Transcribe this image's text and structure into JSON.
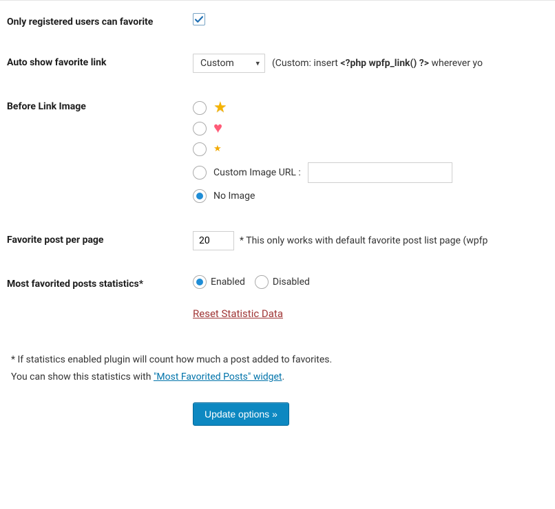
{
  "rows": {
    "registered": {
      "label": "Only registered users can favorite",
      "checked": true
    },
    "autoshow": {
      "label": "Auto show favorite link",
      "selected": "Custom",
      "help_prefix": "(Custom: insert ",
      "help_code": "<?php wpfp_link() ?>",
      "help_suffix": " wherever yo"
    },
    "before_image": {
      "label": "Before Link Image",
      "custom_label": "Custom Image URL :",
      "custom_value": "",
      "noimage_label": "No Image",
      "selected": "noimage"
    },
    "per_page": {
      "label": "Favorite post per page",
      "value": "20",
      "hint": "* This only works with default favorite post list page (wpfp"
    },
    "stats": {
      "label": "Most favorited posts statistics*",
      "enabled_label": "Enabled",
      "disabled_label": "Disabled",
      "value": "enabled"
    },
    "reset_link": "Reset Statistic Data"
  },
  "note": {
    "line1": "* If statistics enabled plugin will count how much a post added to favorites.",
    "line2_prefix": "You can show this statistics with ",
    "line2_link": "\"Most Favorited Posts\" widget",
    "line2_suffix": "."
  },
  "submit_label": "Update options »"
}
